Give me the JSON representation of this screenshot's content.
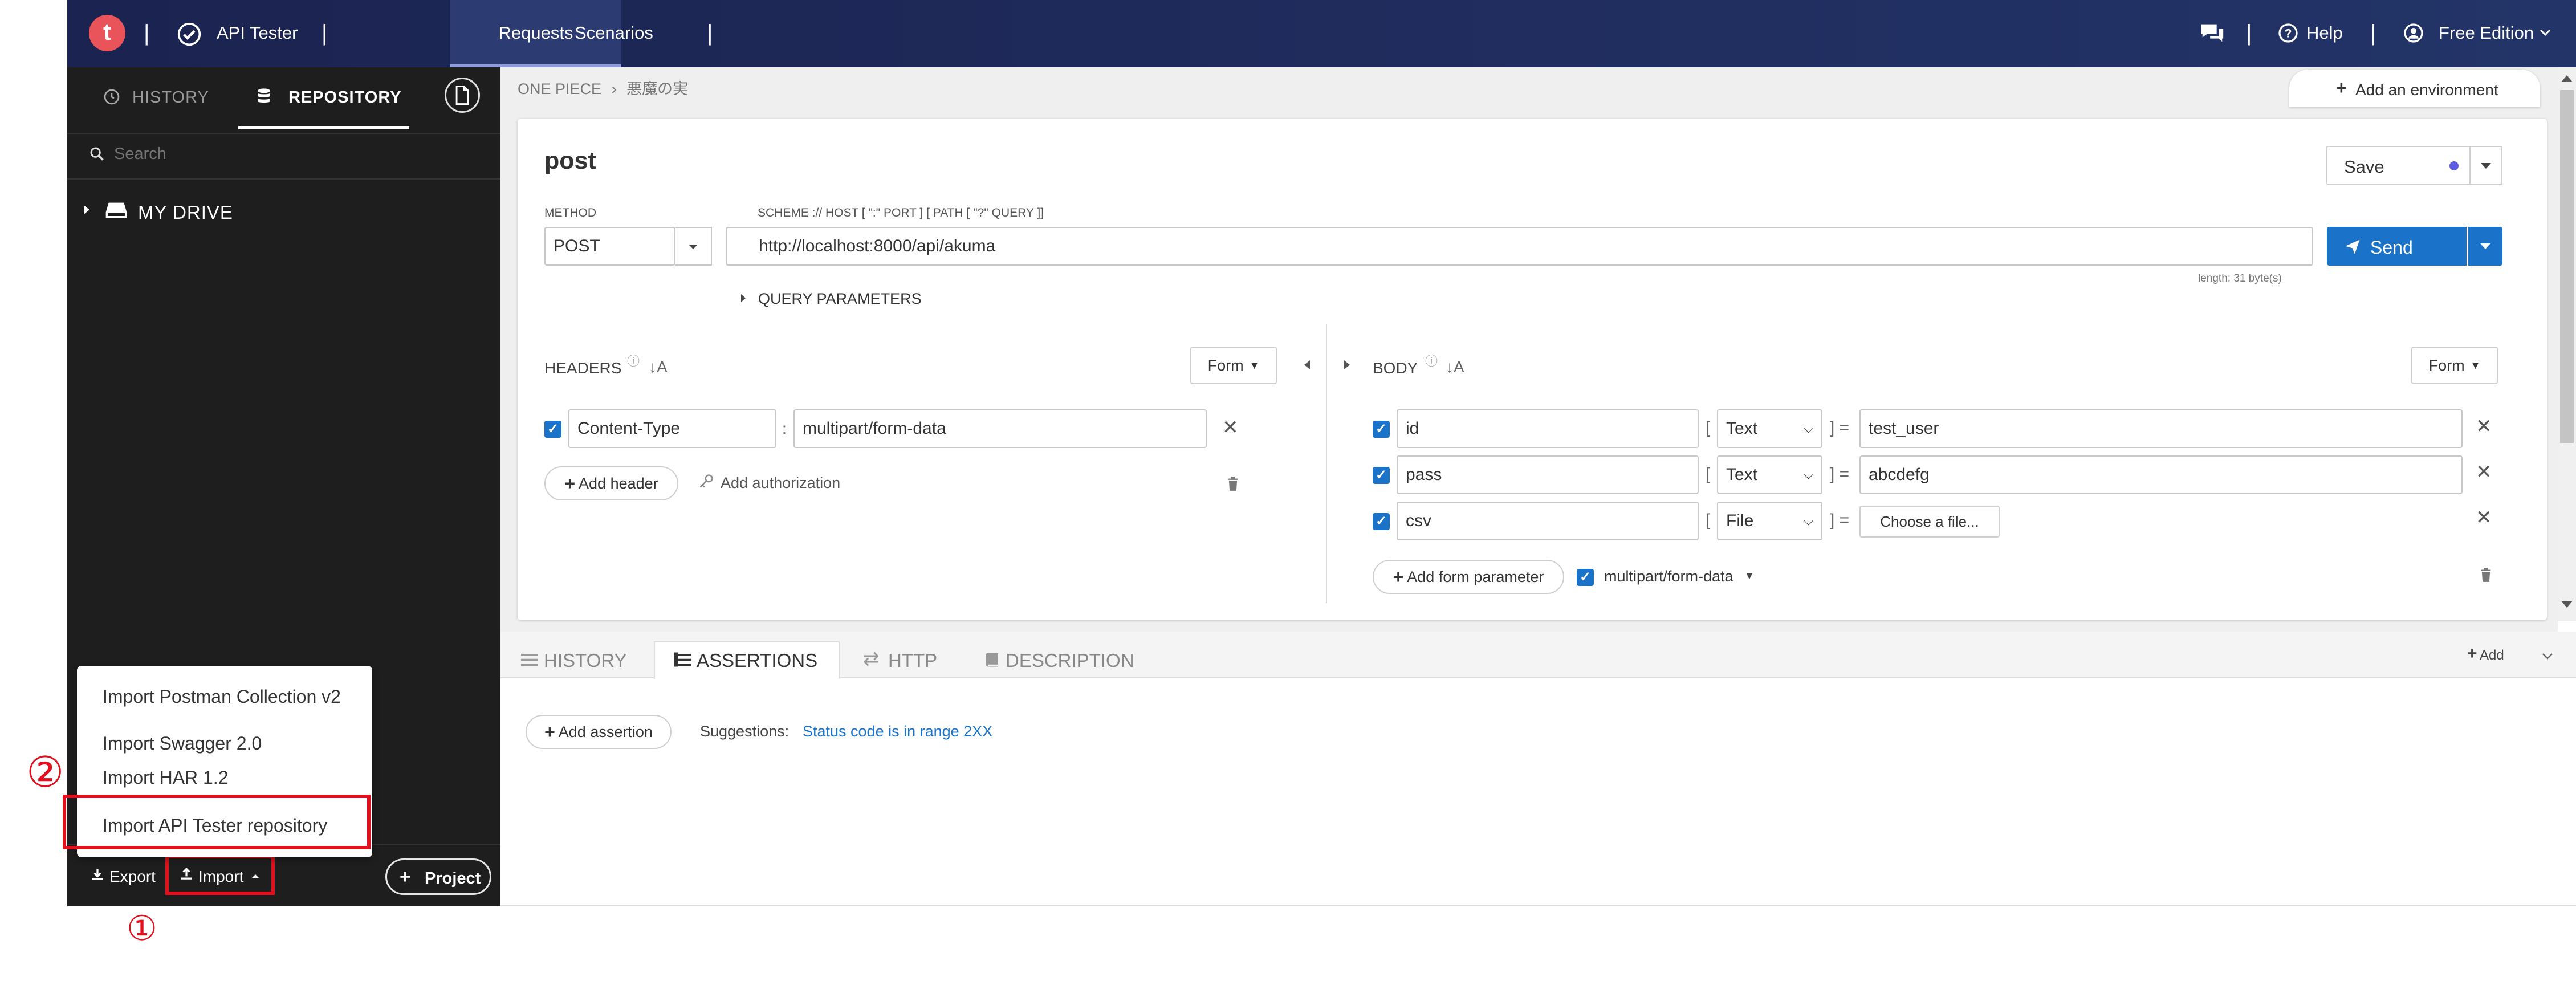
{
  "topbar": {
    "logo": "t",
    "app_name": "API Tester",
    "tab_requests": "Requests",
    "tab_scenarios": "Scenarios",
    "help": "Help",
    "edition": "Free Edition",
    "separator": "|"
  },
  "sidebar": {
    "tab_history": "HISTORY",
    "tab_repository": "REPOSITORY",
    "search_placeholder": "Search",
    "drive_label": "MY DRIVE",
    "export_label": "Export",
    "import_label": "Import",
    "project_label": "Project"
  },
  "import_menu": {
    "items": [
      "Import Postman Collection v2",
      "Import Swagger 2.0",
      "Import HAR 1.2",
      "Import API Tester repository"
    ]
  },
  "annotations": {
    "step1": "①",
    "step2": "②"
  },
  "breadcrumb": {
    "project": "ONE PIECE",
    "folder": "悪魔の実"
  },
  "add_environment": "Add an environment",
  "request": {
    "name": "post",
    "save_label": "Save",
    "method_label": "METHOD",
    "method": "POST",
    "url_label": "SCHEME :// HOST [ \":\" PORT ] [ PATH [ \"?\" QUERY ]]",
    "url": "http://localhost:8000/api/akuma",
    "send_label": "Send",
    "length_info": "length: 31 byte(s)",
    "query_params": "QUERY PARAMETERS"
  },
  "headers": {
    "title": "HEADERS",
    "form_label": "Form",
    "rows": [
      {
        "key": "Content-Type",
        "value": "multipart/form-data"
      }
    ],
    "add_header": "Add header",
    "add_authorization": "Add authorization"
  },
  "body": {
    "title": "BODY",
    "form_label": "Form",
    "rows": [
      {
        "key": "id",
        "type": "Text",
        "value": "test_user"
      },
      {
        "key": "pass",
        "type": "Text",
        "value": "abcdefg"
      },
      {
        "key": "csv",
        "type": "File",
        "value": "Choose a file..."
      }
    ],
    "add_param": "Add form parameter",
    "content_type": "multipart/form-data"
  },
  "bottom": {
    "tabs": [
      "HISTORY",
      "ASSERTIONS",
      "HTTP",
      "DESCRIPTION"
    ],
    "add_label": "Add",
    "add_assertion": "Add assertion",
    "suggestions_label": "Suggestions:",
    "suggestion": "Status code is in range 2XX"
  },
  "colors": {
    "topbar": "#1b2350",
    "sidebar": "#1e1e1e",
    "accent": "#1a73c9",
    "highlight": "#e0101e"
  }
}
